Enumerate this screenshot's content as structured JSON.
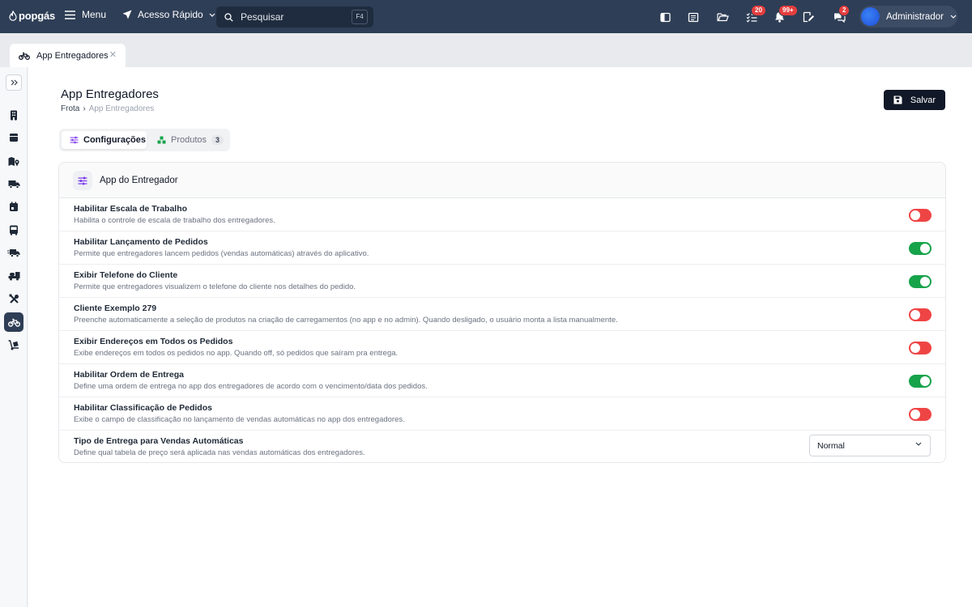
{
  "topbar": {
    "logo": "popgás",
    "menu_label": "Menu",
    "quick_access_label": "Acesso Rápido",
    "search_placeholder": "Pesquisar",
    "search_shortcut": "F4",
    "badges": {
      "tasks": "20",
      "notifications": "99+",
      "messages": "2"
    },
    "user_name": "Administrador"
  },
  "doc_tab": {
    "label": "App Entregadores"
  },
  "page": {
    "title": "App Entregadores",
    "breadcrumb": {
      "parent": "Frota",
      "separator": "›",
      "current": "App Entregadores"
    },
    "save_label": "Salvar"
  },
  "tabs": [
    {
      "label": "Configurações",
      "active": true
    },
    {
      "label": "Produtos",
      "count": "3",
      "active": false
    }
  ],
  "card": {
    "title": "App do Entregador",
    "settings": [
      {
        "title": "Habilitar Escala de Trabalho",
        "description": "Habilita o controle de escala de trabalho dos entregadores.",
        "enabled": false
      },
      {
        "title": "Habilitar Lançamento de Pedidos",
        "description": "Permite que entregadores lancem pedidos (vendas automáticas) através do aplicativo.",
        "enabled": true
      },
      {
        "title": "Exibir Telefone do Cliente",
        "description": "Permite que entregadores visualizem o telefone do cliente nos detalhes do pedido.",
        "enabled": true
      },
      {
        "title": "Cliente Exemplo 279",
        "description": "Preenche automaticamente a seleção de produtos na criação de carregamentos (no app e no admin). Quando desligado, o usuário monta a lista manualmente.",
        "enabled": false
      },
      {
        "title": "Exibir Endereços em Todos os Pedidos",
        "description": "Exibe endereços em todos os pedidos no app. Quando off, só pedidos que saíram pra entrega.",
        "enabled": false
      },
      {
        "title": "Habilitar Ordem de Entrega",
        "description": "Define uma ordem de entrega no app dos entregadores de acordo com o vencimento/data dos pedidos.",
        "enabled": true
      },
      {
        "title": "Habilitar Classificação de Pedidos",
        "description": "Exibe o campo de classificação no lançamento de vendas automáticas no app dos entregadores.",
        "enabled": false
      }
    ],
    "delivery_type": {
      "title": "Tipo de Entrega para Vendas Automáticas",
      "description": "Define qual tabela de preço será aplicada nas vendas automáticas dos entregadores.",
      "selected": "Normal"
    }
  },
  "colors": {
    "topbar": "#2e3e56",
    "toggle_on": "#16a34a",
    "toggle_off": "#ef4444",
    "accent_purple": "#7c3aed",
    "badge": "#e53e3e"
  }
}
